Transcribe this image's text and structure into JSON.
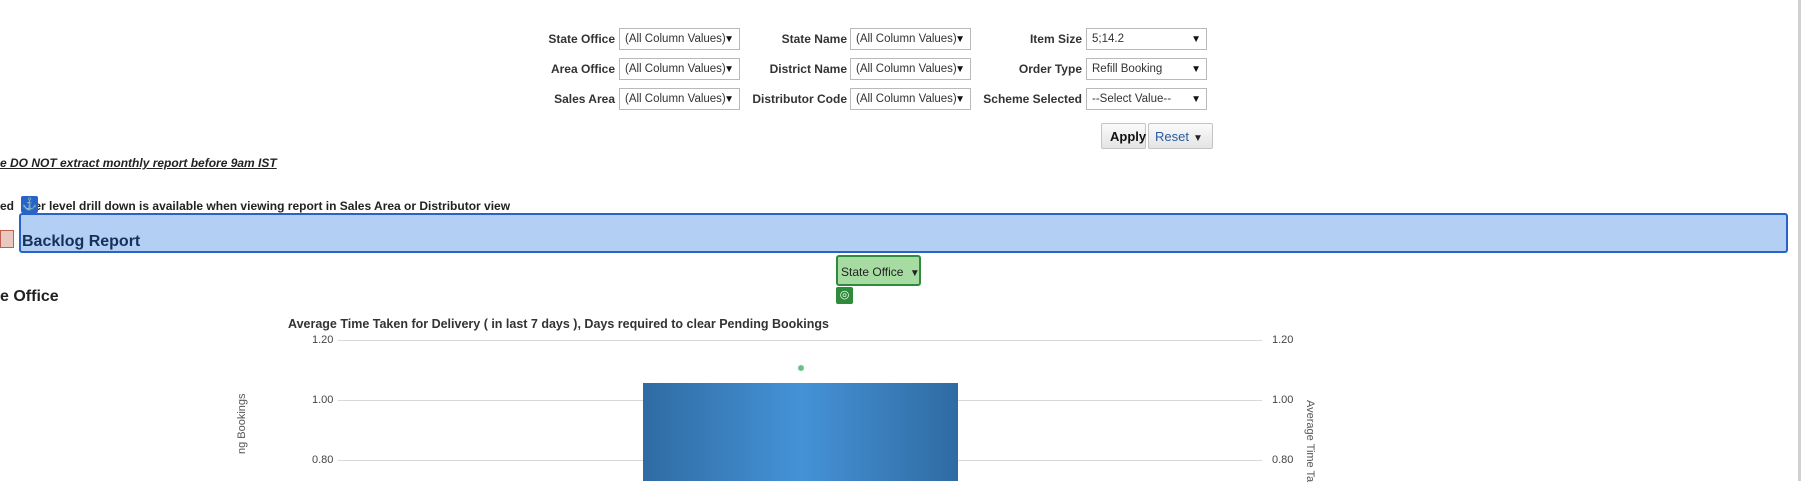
{
  "filters": {
    "state_office": {
      "label": "State Office",
      "value": "(All Column Values)"
    },
    "state_name": {
      "label": "State Name",
      "value": "(All Column Values)"
    },
    "item_size": {
      "label": "Item Size",
      "value": "5;14.2"
    },
    "area_office": {
      "label": "Area Office",
      "value": "(All Column Values)"
    },
    "district_name": {
      "label": "District Name",
      "value": "(All Column Values)"
    },
    "order_type": {
      "label": "Order Type",
      "value": "Refill Booking"
    },
    "sales_area": {
      "label": "Sales Area",
      "value": "(All Column Values)"
    },
    "distributor_code": {
      "label": "Distributor Code",
      "value": "(All Column Values)"
    },
    "scheme_selected": {
      "label": "Scheme Selected",
      "value": "--Select Value--"
    },
    "apply_label": "Apply",
    "reset_label": "Reset"
  },
  "notices": {
    "monthly": "e DO NOT extract monthly report before 9am IST",
    "drilldown_prefix": "ed",
    "drilldown_rest": "er level drill down is available when viewing report in Sales Area or Distributor view"
  },
  "section": {
    "title": "Backlog Report"
  },
  "view_selector": {
    "value": "State Office"
  },
  "subheading": "e Office",
  "chart_data": {
    "type": "bar",
    "title": "Average Time Taken for Delivery ( in last 7 days ), Days required to clear Pending Bookings",
    "ylabel_left": "ng Bookings",
    "ylabel_right": "Average Time Ta",
    "y_ticks_left": [
      "1.20",
      "1.00",
      "0.80"
    ],
    "y_ticks_right": [
      "1.20",
      "1.00",
      "0.80"
    ],
    "ylim": [
      0,
      1.2
    ],
    "series": [
      {
        "values": [
          1.0
        ],
        "kind": "bar"
      },
      {
        "values": [
          1.1
        ],
        "kind": "point"
      }
    ],
    "colors": {
      "bar": "#3a7cc0",
      "point": "#6cc089"
    }
  }
}
